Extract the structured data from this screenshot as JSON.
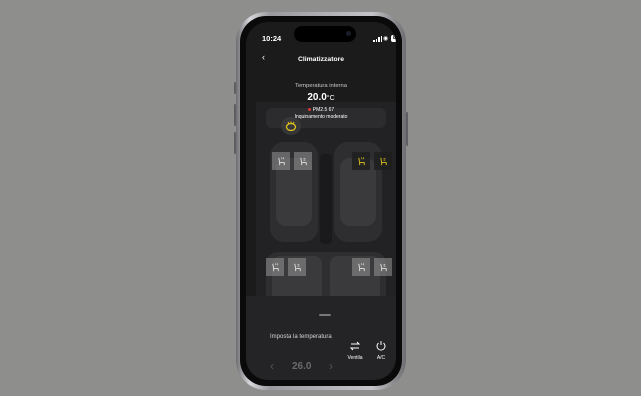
{
  "status_bar": {
    "time": "10:24",
    "battery": "80"
  },
  "header": {
    "title": "Climatizzatore"
  },
  "climate": {
    "label": "Temperatura interna",
    "temperature": "20.0",
    "unit": "°C",
    "pm_label": "PM2.5",
    "pm_value": "67",
    "air_quality": "Inquinamento moderato"
  },
  "controls": {
    "set_temp_label": "Imposta la temperatura",
    "set_temp_value": "26.0",
    "ventilation_label": "Ventila",
    "ac_label": "A/C"
  },
  "colors": {
    "active": "#e2c51c",
    "inactive": "#e2e2e2",
    "background": "#8e8e8c"
  },
  "seats": [
    {
      "name": "front-left",
      "active": false
    },
    {
      "name": "front-right",
      "active": true
    },
    {
      "name": "rear-left",
      "active": false
    },
    {
      "name": "rear-right",
      "active": false
    }
  ]
}
